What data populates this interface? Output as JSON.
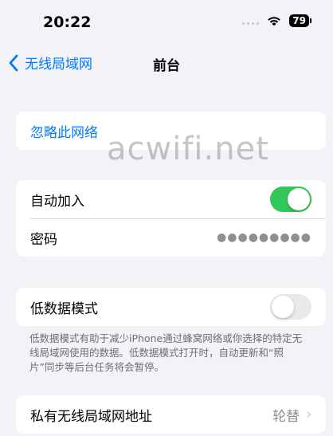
{
  "status_bar": {
    "time": "20:22",
    "battery": "79"
  },
  "nav": {
    "back_label": "无线局域网",
    "title": "前台"
  },
  "forget_section": {
    "forget_label": "忽略此网络"
  },
  "network_section": {
    "auto_join_label": "自动加入",
    "auto_join_on": true,
    "password_label": "密码",
    "password_masked": "●●●●●●●●●"
  },
  "low_data_section": {
    "label": "低数据模式",
    "enabled": false,
    "description": "低数据模式有助于减少iPhone通过蜂窝网络或你选择的特定无线局域网使用的数据。低数据模式打开时，自动更新和“照片”同步等后台任务将会暂停。"
  },
  "private_address_section": {
    "label": "私有无线局域网地址",
    "value": "轮替"
  },
  "watermark": "acwifi.net",
  "colors": {
    "accent": "#007aff",
    "toggle_on": "#34c759",
    "toggle_off": "#e9e9eb",
    "background": "#f2f2f7"
  }
}
